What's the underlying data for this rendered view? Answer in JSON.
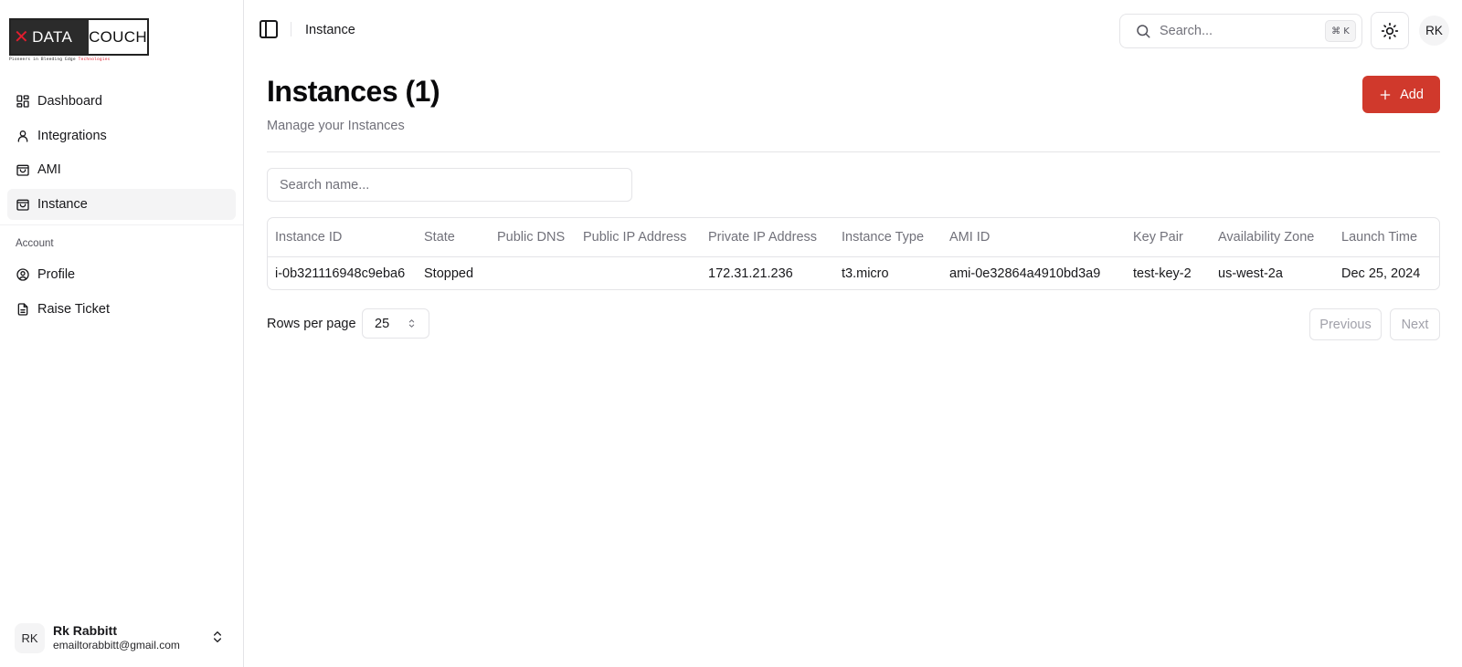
{
  "brand": {
    "left": "DATA",
    "right": "COUCH",
    "tagline_main": "Pioneers in Bleeding Edge",
    "tagline_accent": "Technologies",
    "accent_color": "#e11d2e"
  },
  "sidebar": {
    "items": [
      {
        "label": "Dashboard",
        "icon": "dashboard-icon"
      },
      {
        "label": "Integrations",
        "icon": "user-icon"
      },
      {
        "label": "AMI",
        "icon": "shopping-bag-icon"
      },
      {
        "label": "Instance",
        "icon": "shopping-bag-icon",
        "active": true
      }
    ],
    "section_label": "Account",
    "account_items": [
      {
        "label": "Profile",
        "icon": "user-circle-icon"
      },
      {
        "label": "Raise Ticket",
        "icon": "file-text-icon"
      }
    ],
    "user": {
      "initials": "RK",
      "name": "Rk Rabbitt",
      "email": "emailtorabbitt@gmail.com"
    }
  },
  "header": {
    "breadcrumb": "Instance",
    "search_placeholder": "Search...",
    "shortcut": "⌘ K",
    "avatar_initials": "RK"
  },
  "page": {
    "title": "Instances (1)",
    "subtitle": "Manage your Instances",
    "add_label": "Add",
    "accent_color": "#d0392c",
    "filter_placeholder": "Search name..."
  },
  "table": {
    "columns": [
      "Instance ID",
      "State",
      "Public DNS",
      "Public IP Address",
      "Private IP Address",
      "Instance Type",
      "AMI ID",
      "Key Pair",
      "Availability Zone",
      "Launch Time"
    ],
    "rows": [
      [
        "i-0b321116948c9eba6",
        "Stopped",
        "",
        "",
        "172.31.21.236",
        "t3.micro",
        "ami-0e32864a4910bd3a9",
        "test-key-2",
        "us-west-2a",
        "Dec 25, 2024"
      ]
    ]
  },
  "pagination": {
    "rows_label": "Rows per page",
    "rows_value": "25",
    "previous_label": "Previous",
    "next_label": "Next"
  }
}
